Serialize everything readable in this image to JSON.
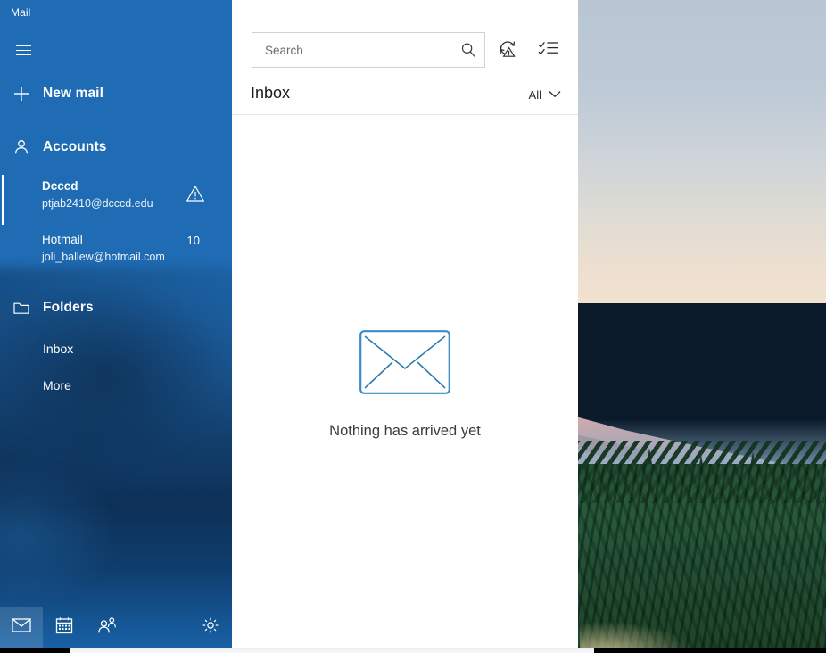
{
  "window": {
    "app_title": "Mail"
  },
  "nav": {
    "menu_icon": "hamburger-icon",
    "new_mail_label": "New mail",
    "accounts_label": "Accounts",
    "folders_label": "Folders",
    "accounts": [
      {
        "name": "Dcccd",
        "address": "ptjab2410@dcccd.edu",
        "badge": "",
        "status_icon": "warning-icon",
        "selected": true
      },
      {
        "name": "Hotmail",
        "address": "joli_ballew@hotmail.com",
        "badge": "10",
        "status_icon": "",
        "selected": false
      }
    ],
    "folders": [
      {
        "label": "Inbox"
      },
      {
        "label": "More"
      }
    ],
    "bottom_buttons": [
      {
        "icon": "mail-icon",
        "selected": true
      },
      {
        "icon": "calendar-icon",
        "selected": false
      },
      {
        "icon": "people-icon",
        "selected": false
      },
      {
        "icon": "settings-gear-icon",
        "selected": false
      }
    ]
  },
  "list": {
    "search": {
      "value": "",
      "placeholder": "Search",
      "icon": "search-icon"
    },
    "toolbar": [
      {
        "icon": "sync-error-icon"
      },
      {
        "icon": "selection-mode-icon"
      }
    ],
    "title": "Inbox",
    "filter": {
      "label": "All",
      "icon": "chevron-down-icon"
    },
    "empty_state": {
      "icon": "envelope-icon",
      "message": "Nothing has arrived yet"
    }
  },
  "colors": {
    "accent_blue": "#1f6cb4",
    "envelope_blue": "#3a8cc8",
    "panel_white": "#ffffff",
    "border_gray": "#d2d2d2"
  }
}
